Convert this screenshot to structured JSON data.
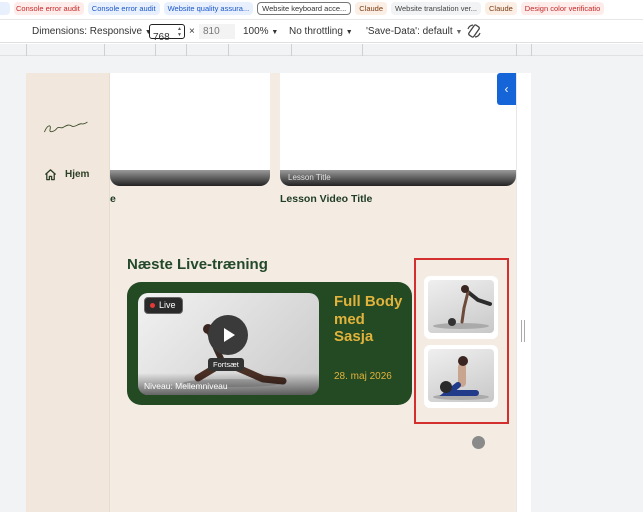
{
  "bookmarks": [
    {
      "label": "Console error audit",
      "style": "red"
    },
    {
      "label": "Console error audit",
      "style": "blue"
    },
    {
      "label": "Website quality assura...",
      "style": "blue"
    },
    {
      "label": "Website keyboard acce...",
      "style": "outline"
    },
    {
      "label": "Claude",
      "style": "peach"
    },
    {
      "label": "Website translation ver...",
      "style": "grey"
    },
    {
      "label": "Claude",
      "style": "peach"
    },
    {
      "label": "Design color verificatio",
      "style": "red"
    }
  ],
  "toolbar": {
    "dimensions_label": "Dimensions: Responsive",
    "width": "768",
    "times": "×",
    "height": "810",
    "zoom": "100%",
    "throttle": "No throttling",
    "save_data": "'Save-Data': default"
  },
  "sidebar": {
    "logo_text": "Sasja Lemmens",
    "nav": [
      {
        "label": "Hjem",
        "icon": "home-icon"
      }
    ]
  },
  "lessons": [
    {
      "title": "Lesson Title",
      "caption": "Lesson Video Title"
    }
  ],
  "partial_caption_char": "e",
  "section": {
    "title": "Næste Live-træning"
  },
  "live_event": {
    "badge": "Live",
    "continue_label": "Fortsæt",
    "level": "Niveau: Mellemniveau",
    "title": "Full Body med Sasja",
    "date": "28. maj 2026"
  },
  "carousel": {
    "next_glyph": "‹"
  },
  "colors": {
    "page_bg": "#f4ece3",
    "primary_green": "#234a22",
    "accent_gold": "#e2b33c",
    "highlight_red": "#d32f2f",
    "nav_blue": "#1565d8"
  }
}
